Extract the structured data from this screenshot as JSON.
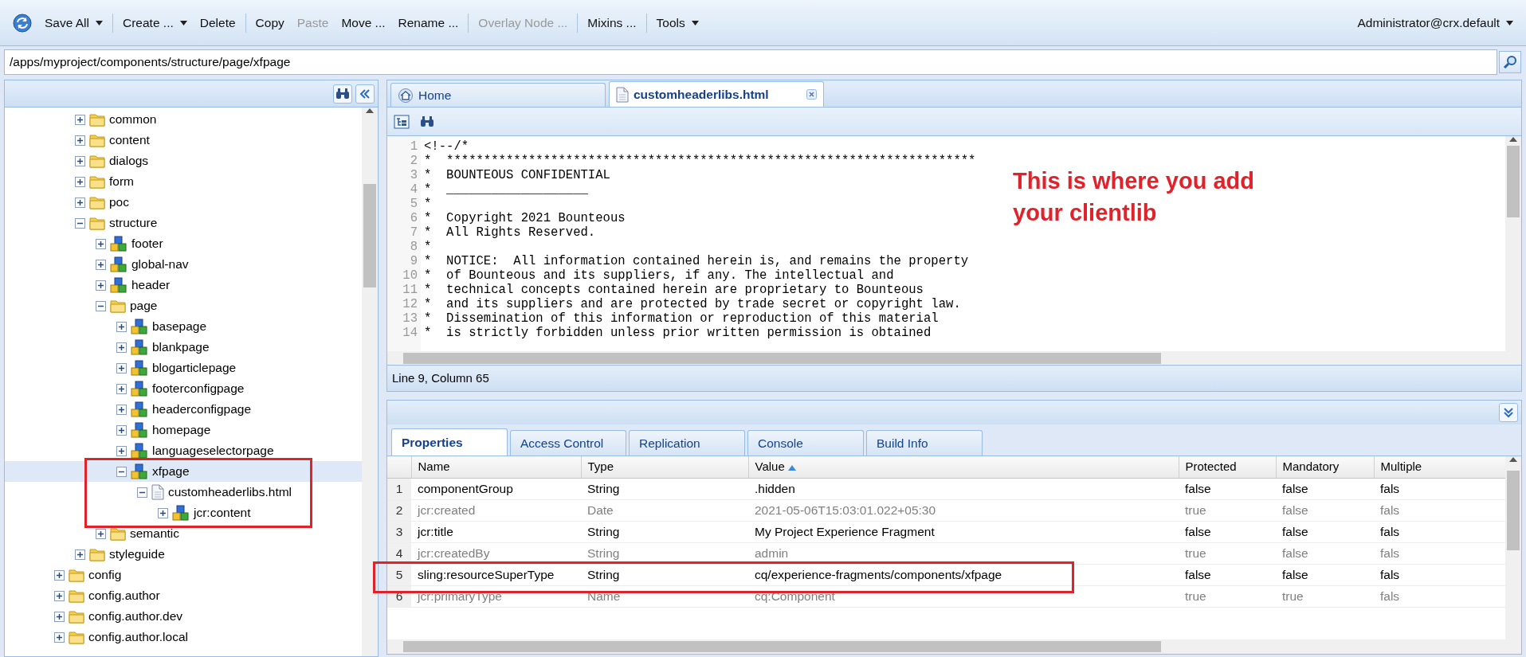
{
  "toolbar": {
    "items": [
      {
        "label": "Save All",
        "caret": true,
        "disabled": false,
        "separator_after": true
      },
      {
        "label": "Create ...",
        "caret": true,
        "disabled": false,
        "separator_after": false
      },
      {
        "label": "Delete",
        "caret": false,
        "disabled": false,
        "separator_after": true
      },
      {
        "label": "Copy",
        "caret": false,
        "disabled": false,
        "separator_after": false
      },
      {
        "label": "Paste",
        "caret": false,
        "disabled": true,
        "separator_after": false
      },
      {
        "label": "Move ...",
        "caret": false,
        "disabled": false,
        "separator_after": false
      },
      {
        "label": "Rename ...",
        "caret": false,
        "disabled": false,
        "separator_after": true
      },
      {
        "label": "Overlay Node ...",
        "caret": false,
        "disabled": true,
        "separator_after": true
      },
      {
        "label": "Mixins ...",
        "caret": false,
        "disabled": false,
        "separator_after": true
      },
      {
        "label": "Tools",
        "caret": true,
        "disabled": false,
        "separator_after": false
      }
    ],
    "user": "Administrator@crx.default"
  },
  "path_field": {
    "value": "/apps/myproject/components/structure/page/xfpage"
  },
  "tree": {
    "items": [
      {
        "children": [
          {
            "label": "common",
            "kind": "folder",
            "expanded": false,
            "selected": false
          },
          {
            "label": "content",
            "kind": "folder",
            "expanded": false,
            "selected": false
          },
          {
            "label": "dialogs",
            "kind": "folder",
            "expanded": false,
            "selected": false
          },
          {
            "label": "form",
            "kind": "folder",
            "expanded": false,
            "selected": false
          },
          {
            "label": "poc",
            "kind": "folder",
            "expanded": false,
            "selected": false
          },
          {
            "label": "structure",
            "kind": "folder",
            "expanded": true,
            "selected": false,
            "children": [
              {
                "label": "footer",
                "kind": "component",
                "expanded": false,
                "selected": false
              },
              {
                "label": "global-nav",
                "kind": "component",
                "expanded": false,
                "selected": false
              },
              {
                "label": "header",
                "kind": "component",
                "expanded": false,
                "selected": false
              },
              {
                "label": "page",
                "kind": "folder",
                "expanded": true,
                "selected": false,
                "children": [
                  {
                    "label": "basepage",
                    "kind": "component",
                    "expanded": false,
                    "selected": false
                  },
                  {
                    "label": "blankpage",
                    "kind": "component",
                    "expanded": false,
                    "selected": false
                  },
                  {
                    "label": "blogarticlepage",
                    "kind": "component",
                    "expanded": false,
                    "selected": false
                  },
                  {
                    "label": "footerconfigpage",
                    "kind": "component",
                    "expanded": false,
                    "selected": false
                  },
                  {
                    "label": "headerconfigpage",
                    "kind": "component",
                    "expanded": false,
                    "selected": false
                  },
                  {
                    "label": "homepage",
                    "kind": "component",
                    "expanded": false,
                    "selected": false
                  },
                  {
                    "label": "languageselectorpage",
                    "kind": "component",
                    "expanded": false,
                    "selected": false
                  },
                  {
                    "label": "xfpage",
                    "kind": "component",
                    "expanded": true,
                    "selected": true,
                    "annotated": true,
                    "children": [
                      {
                        "label": "customheaderlibs.html",
                        "kind": "file",
                        "expanded": true,
                        "selected": false,
                        "children": [
                          {
                            "label": "jcr:content",
                            "kind": "component",
                            "expanded": false,
                            "selected": false
                          }
                        ]
                      }
                    ]
                  }
                ]
              },
              {
                "label": "semantic",
                "kind": "folder",
                "expanded": false,
                "selected": false
              }
            ]
          },
          {
            "label": "styleguide",
            "kind": "folder",
            "expanded": false,
            "selected": false
          }
        ]
      },
      {
        "label": "config",
        "kind": "folder",
        "expanded": false,
        "selected": false
      },
      {
        "label": "config.author",
        "kind": "folder",
        "expanded": false,
        "selected": false
      },
      {
        "label": "config.author.dev",
        "kind": "folder",
        "expanded": false,
        "selected": false
      },
      {
        "label": "config.author.local",
        "kind": "folder",
        "expanded": false,
        "selected": false
      }
    ]
  },
  "editor": {
    "tabs": [
      {
        "label": "Home",
        "kind": "home",
        "selected": false,
        "closable": false
      },
      {
        "label": "customheaderlibs.html",
        "kind": "file",
        "selected": true,
        "closable": true
      }
    ],
    "lines": [
      {
        "number": "1",
        "text": "<!--/*"
      },
      {
        "number": "2",
        "text": "*  ***********************************************************************"
      },
      {
        "number": "3",
        "text": "*  BOUNTEOUS CONFIDENTIAL"
      },
      {
        "number": "4",
        "text": "*  ___________________"
      },
      {
        "number": "5",
        "text": "*"
      },
      {
        "number": "6",
        "text": "*  Copyright 2021 Bounteous"
      },
      {
        "number": "7",
        "text": "*  All Rights Reserved."
      },
      {
        "number": "8",
        "text": "*"
      },
      {
        "number": "9",
        "text": "*  NOTICE:  All information contained herein is, and remains the property"
      },
      {
        "number": "10",
        "text": "*  of Bounteous and its suppliers, if any. The intellectual and"
      },
      {
        "number": "11",
        "text": "*  technical concepts contained herein are proprietary to Bounteous"
      },
      {
        "number": "12",
        "text": "*  and its suppliers and are protected by trade secret or copyright law."
      },
      {
        "number": "13",
        "text": "*  Dissemination of this information or reproduction of this material"
      },
      {
        "number": "14",
        "text": "*  is strictly forbidden unless prior written permission is obtained"
      }
    ],
    "annotation": "This is where you add your clientlib",
    "status": "Line 9, Column 65"
  },
  "properties": {
    "tabs": [
      {
        "label": "Properties",
        "selected": true
      },
      {
        "label": "Access Control",
        "selected": false
      },
      {
        "label": "Replication",
        "selected": false
      },
      {
        "label": "Console",
        "selected": false
      },
      {
        "label": "Build Info",
        "selected": false
      }
    ],
    "columns": [
      {
        "label": "Name",
        "sorted": false
      },
      {
        "label": "Type",
        "sorted": false
      },
      {
        "label": "Value",
        "sorted": true
      },
      {
        "label": "Protected",
        "sorted": false
      },
      {
        "label": "Mandatory",
        "sorted": false
      },
      {
        "label": "Multiple",
        "sorted": false
      }
    ],
    "rows": [
      {
        "number": "1",
        "cells": [
          "componentGroup",
          "String",
          ".hidden",
          "false",
          "false",
          "fals"
        ],
        "greyed": false
      },
      {
        "number": "2",
        "cells": [
          "jcr:created",
          "Date",
          "2021-05-06T15:03:01.022+05:30",
          "true",
          "false",
          "fals"
        ],
        "greyed": true
      },
      {
        "number": "3",
        "cells": [
          "jcr:title",
          "String",
          "My Project Experience Fragment",
          "false",
          "false",
          "fals"
        ],
        "greyed": false
      },
      {
        "number": "4",
        "cells": [
          "jcr:createdBy",
          "String",
          "admin",
          "true",
          "false",
          "fals"
        ],
        "greyed": true
      },
      {
        "number": "5",
        "cells": [
          "sling:resourceSuperType",
          "String",
          "cq/experience-fragments/components/xfpage",
          "false",
          "false",
          "fals"
        ],
        "greyed": false,
        "annotated": true
      },
      {
        "number": "6",
        "cells": [
          "jcr:primaryType",
          "Name",
          "cq:Component",
          "true",
          "true",
          "fals"
        ],
        "greyed": true
      }
    ]
  }
}
